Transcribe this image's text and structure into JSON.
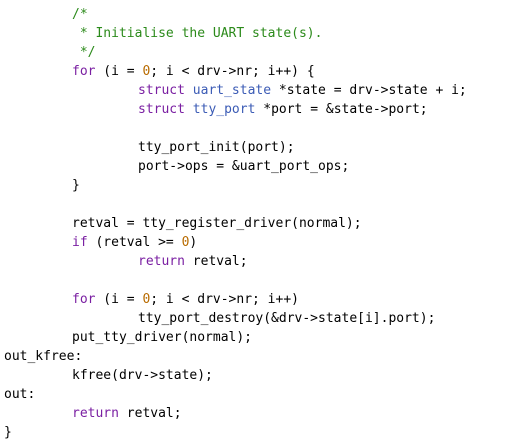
{
  "colors": {
    "background": "#ffffff",
    "text": "#000000",
    "keyword": "#7a1fa2",
    "type": "#3b5bb5",
    "comment": "#2b8a1a",
    "number": "#b86b00",
    "function": "#000000"
  },
  "lines": [
    {
      "indent": 72,
      "tokens": [
        {
          "t": "/*",
          "c": "comment"
        }
      ]
    },
    {
      "indent": 72,
      "tokens": [
        {
          "t": " * Initialise the UART state(s).",
          "c": "comment"
        }
      ]
    },
    {
      "indent": 72,
      "tokens": [
        {
          "t": " */",
          "c": "comment"
        }
      ]
    },
    {
      "indent": 72,
      "tokens": [
        {
          "t": "for",
          "c": "keyword"
        },
        {
          "t": " (i = "
        },
        {
          "t": "0",
          "c": "number"
        },
        {
          "t": "; i < drv->nr; i++) {"
        }
      ]
    },
    {
      "indent": 138,
      "tokens": [
        {
          "t": "struct",
          "c": "keyword"
        },
        {
          "t": " "
        },
        {
          "t": "uart_state",
          "c": "type"
        },
        {
          "t": " *state = drv->state + i;"
        }
      ]
    },
    {
      "indent": 138,
      "tokens": [
        {
          "t": "struct",
          "c": "keyword"
        },
        {
          "t": " "
        },
        {
          "t": "tty_port",
          "c": "type"
        },
        {
          "t": " *port = &state->port;"
        }
      ]
    },
    {
      "indent": 138,
      "tokens": []
    },
    {
      "indent": 138,
      "tokens": [
        {
          "t": "tty_port_init(port);"
        }
      ]
    },
    {
      "indent": 138,
      "tokens": [
        {
          "t": "port->ops = &uart_port_ops;"
        }
      ]
    },
    {
      "indent": 72,
      "tokens": [
        {
          "t": "}"
        }
      ]
    },
    {
      "indent": 72,
      "tokens": []
    },
    {
      "indent": 72,
      "tokens": [
        {
          "t": "retval = tty_register_driver(normal);"
        }
      ]
    },
    {
      "indent": 72,
      "tokens": [
        {
          "t": "if",
          "c": "keyword"
        },
        {
          "t": " (retval >= "
        },
        {
          "t": "0",
          "c": "number"
        },
        {
          "t": ")"
        }
      ]
    },
    {
      "indent": 138,
      "tokens": [
        {
          "t": "return",
          "c": "keyword"
        },
        {
          "t": " retval;"
        }
      ]
    },
    {
      "indent": 72,
      "tokens": []
    },
    {
      "indent": 72,
      "tokens": [
        {
          "t": "for",
          "c": "keyword"
        },
        {
          "t": " (i = "
        },
        {
          "t": "0",
          "c": "number"
        },
        {
          "t": "; i < drv->nr; i++)"
        }
      ]
    },
    {
      "indent": 138,
      "tokens": [
        {
          "t": "tty_port_destroy(&drv->state[i].port);"
        }
      ]
    },
    {
      "indent": 72,
      "tokens": [
        {
          "t": "put_tty_driver(normal);"
        }
      ]
    },
    {
      "indent": 4,
      "tokens": [
        {
          "t": "out_kfree:"
        }
      ]
    },
    {
      "indent": 72,
      "tokens": [
        {
          "t": "kfree(drv->state);"
        }
      ]
    },
    {
      "indent": 4,
      "tokens": [
        {
          "t": "out:"
        }
      ]
    },
    {
      "indent": 72,
      "tokens": [
        {
          "t": "return",
          "c": "keyword"
        },
        {
          "t": " retval;"
        }
      ]
    },
    {
      "indent": 4,
      "tokens": [
        {
          "t": "}"
        }
      ]
    }
  ]
}
